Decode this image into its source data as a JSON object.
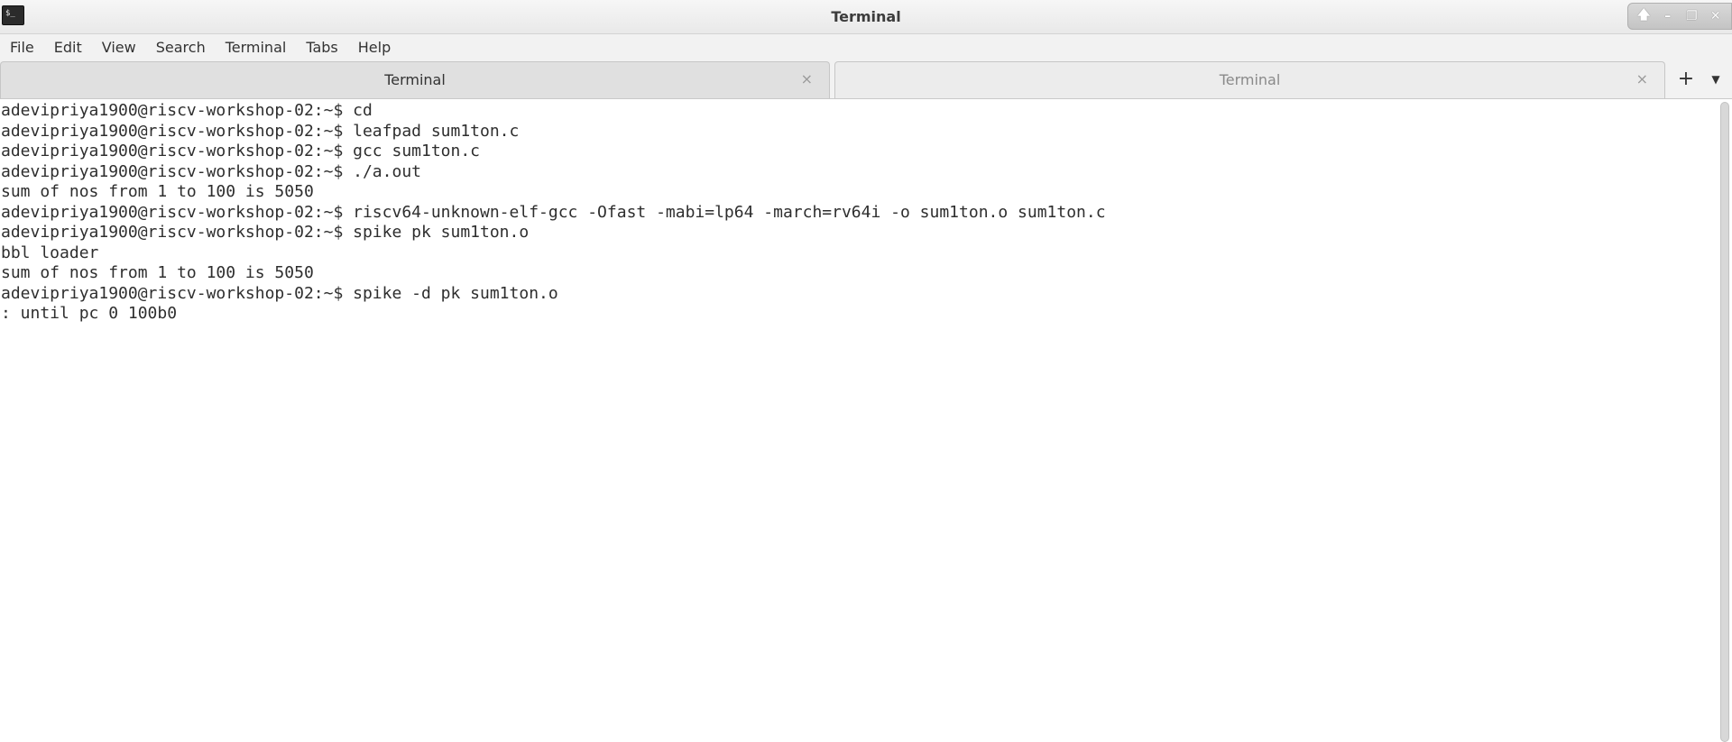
{
  "window": {
    "title": "Terminal",
    "app_icon_glyph": "$_"
  },
  "window_controls": {
    "up_icon": "🡅",
    "minimize_icon": "–",
    "restore_icon": "❐",
    "close_icon": "✕"
  },
  "menubar": {
    "items": [
      {
        "label": "File"
      },
      {
        "label": "Edit"
      },
      {
        "label": "View"
      },
      {
        "label": "Search"
      },
      {
        "label": "Terminal"
      },
      {
        "label": "Tabs"
      },
      {
        "label": "Help"
      }
    ]
  },
  "tabs": [
    {
      "label": "Terminal",
      "active": true,
      "close_glyph": "×"
    },
    {
      "label": "Terminal",
      "active": false,
      "close_glyph": "×"
    }
  ],
  "tab_actions": {
    "new_tab_glyph": "+",
    "tab_menu_glyph": "▼"
  },
  "terminal": {
    "lines": [
      "adevipriya1900@riscv-workshop-02:~$ cd",
      "adevipriya1900@riscv-workshop-02:~$ leafpad sum1ton.c",
      "adevipriya1900@riscv-workshop-02:~$ gcc sum1ton.c",
      "adevipriya1900@riscv-workshop-02:~$ ./a.out",
      "sum of nos from 1 to 100 is 5050",
      "adevipriya1900@riscv-workshop-02:~$ riscv64-unknown-elf-gcc -Ofast -mabi=lp64 -march=rv64i -o sum1ton.o sum1ton.c",
      "adevipriya1900@riscv-workshop-02:~$ spike pk sum1ton.o",
      "bbl loader",
      "sum of nos from 1 to 100 is 5050",
      "adevipriya1900@riscv-workshop-02:~$ spike -d pk sum1ton.o",
      ": until pc 0 100b0"
    ]
  },
  "colors": {
    "background": "#ffffff",
    "text": "#2e2e2e",
    "chrome": "#f2f2f2"
  }
}
